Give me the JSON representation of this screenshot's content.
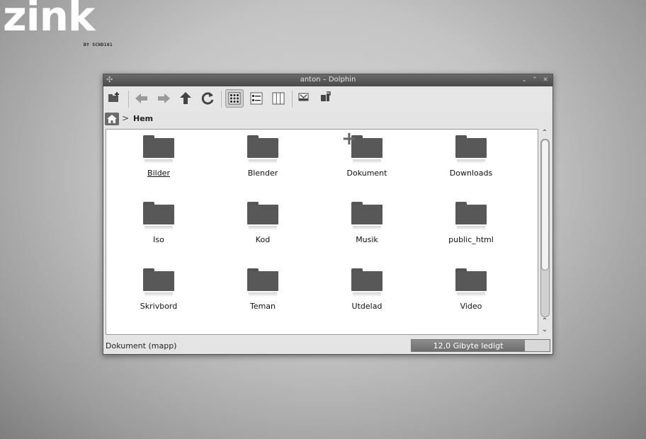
{
  "brand": {
    "logo": "zink",
    "byline": "BY SCND101"
  },
  "window": {
    "title": "anton – Dolphin",
    "controls": [
      "minimize",
      "maximize",
      "close"
    ]
  },
  "toolbar": {
    "buttons": [
      {
        "name": "new-folder",
        "icon": "new-folder-icon"
      },
      {
        "name": "back",
        "icon": "arrow-left-icon"
      },
      {
        "name": "forward",
        "icon": "arrow-right-icon"
      },
      {
        "name": "up",
        "icon": "arrow-up-icon"
      },
      {
        "name": "reload",
        "icon": "reload-icon"
      },
      {
        "name": "icons-view",
        "icon": "icons-view-icon",
        "active": true
      },
      {
        "name": "details-view",
        "icon": "details-view-icon"
      },
      {
        "name": "columns-view",
        "icon": "columns-view-icon"
      },
      {
        "name": "preview",
        "icon": "preview-icon"
      },
      {
        "name": "split",
        "icon": "split-icon"
      }
    ]
  },
  "location": {
    "crumb": "Hem"
  },
  "files": [
    {
      "name": "Bilder",
      "underline": true
    },
    {
      "name": "Blender"
    },
    {
      "name": "Dokument"
    },
    {
      "name": "Downloads"
    },
    {
      "name": "Iso"
    },
    {
      "name": "Kod"
    },
    {
      "name": "Musik"
    },
    {
      "name": "public_html"
    },
    {
      "name": "Skrivbord"
    },
    {
      "name": "Teman"
    },
    {
      "name": "Utdelad"
    },
    {
      "name": "Video"
    }
  ],
  "status": {
    "text": "Dokument (mapp)",
    "free_space": "12,0 Gibyte ledigt",
    "used_fraction": 0.82
  },
  "colors": {
    "titlebar": "#4a4a4a",
    "folder": "#585858",
    "background": "#c4c4c4"
  }
}
